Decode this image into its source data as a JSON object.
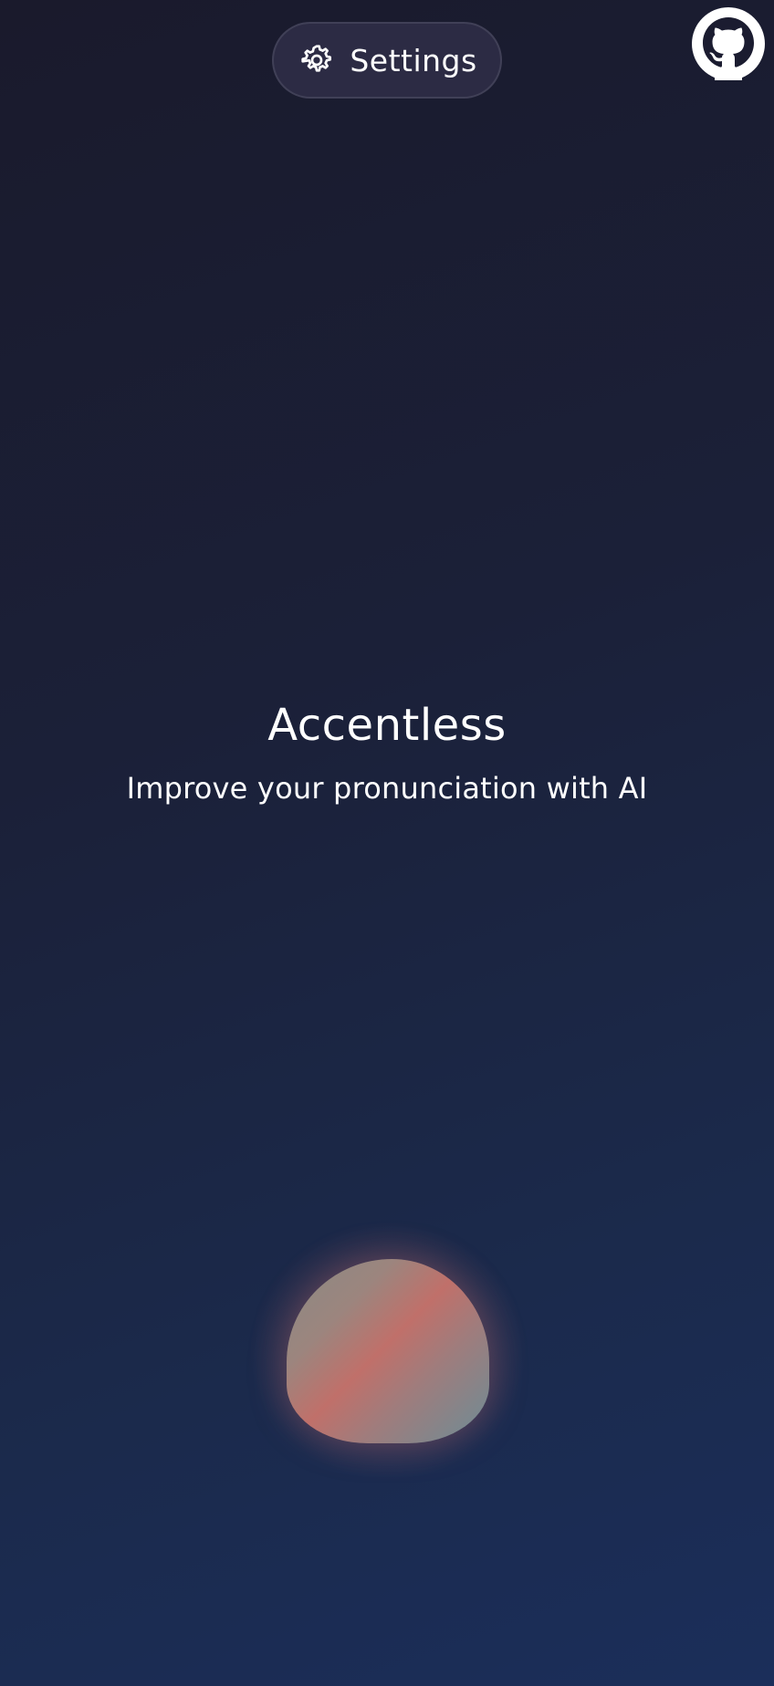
{
  "header": {
    "settings_label": "Settings",
    "settings_icon": "gear-icon",
    "github_icon": "github-icon"
  },
  "hero": {
    "title": "Accentless",
    "subtitle": "Improve your pronunciation with AI"
  },
  "orb": {
    "icon": "voice-orb",
    "colors": [
      "#8a8a84",
      "#c0706a",
      "#6c8d96"
    ]
  },
  "theme": {
    "background_top": "#1a1a2c",
    "background_bottom": "#1b2e5a",
    "button_bg": "#2e2c46"
  }
}
